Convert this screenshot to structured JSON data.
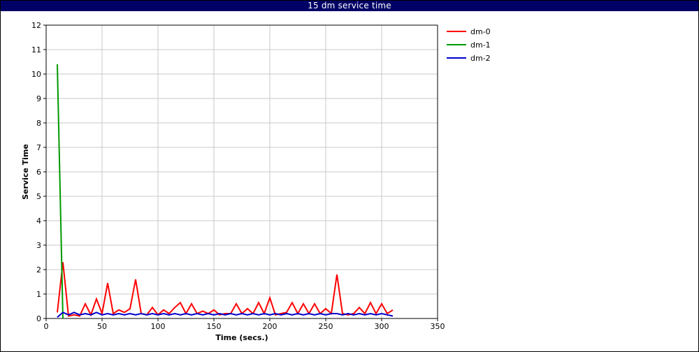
{
  "window": {
    "title": "15 dm service time"
  },
  "chart_data": {
    "type": "line",
    "title": "15 dm service time",
    "xlabel": "Time (secs.)",
    "ylabel": "Service Time",
    "xlim": [
      0,
      350
    ],
    "ylim": [
      0,
      12
    ],
    "xticks": [
      0,
      50,
      100,
      150,
      200,
      250,
      300,
      350
    ],
    "yticks": [
      0,
      1,
      2,
      3,
      4,
      5,
      6,
      7,
      8,
      9,
      10,
      11,
      12
    ],
    "grid": true,
    "legend_position": "top-right (outside plot)",
    "x": [
      10,
      15,
      20,
      25,
      30,
      35,
      40,
      45,
      50,
      55,
      60,
      65,
      70,
      75,
      80,
      85,
      90,
      95,
      100,
      105,
      110,
      115,
      120,
      125,
      130,
      135,
      140,
      145,
      150,
      155,
      160,
      165,
      170,
      175,
      180,
      185,
      190,
      195,
      200,
      205,
      210,
      215,
      220,
      225,
      230,
      235,
      240,
      245,
      250,
      255,
      260,
      265,
      270,
      275,
      280,
      285,
      290,
      295,
      300,
      305,
      310
    ],
    "series": [
      {
        "name": "dm-0",
        "color": "#ff0000",
        "values": [
          0.25,
          2.3,
          0.1,
          0.15,
          0.1,
          0.6,
          0.15,
          0.8,
          0.2,
          1.45,
          0.2,
          0.35,
          0.25,
          0.4,
          1.6,
          0.2,
          0.15,
          0.45,
          0.15,
          0.35,
          0.2,
          0.45,
          0.65,
          0.2,
          0.6,
          0.2,
          0.3,
          0.2,
          0.35,
          0.15,
          0.2,
          0.2,
          0.6,
          0.2,
          0.4,
          0.2,
          0.65,
          0.2,
          0.85,
          0.15,
          0.2,
          0.25,
          0.65,
          0.2,
          0.6,
          0.2,
          0.6,
          0.2,
          0.4,
          0.2,
          1.8,
          0.2,
          0.15,
          0.2,
          0.45,
          0.2,
          0.65,
          0.2,
          0.6,
          0.2,
          0.35
        ]
      },
      {
        "name": "dm-1",
        "color": "#009900",
        "values": [
          10.4,
          0.0
        ]
      },
      {
        "name": "dm-2",
        "color": "#0000cc",
        "values": [
          0.05,
          0.25,
          0.15,
          0.25,
          0.15,
          0.2,
          0.15,
          0.25,
          0.15,
          0.2,
          0.15,
          0.2,
          0.15,
          0.2,
          0.15,
          0.2,
          0.15,
          0.2,
          0.15,
          0.2,
          0.15,
          0.2,
          0.15,
          0.2,
          0.15,
          0.2,
          0.15,
          0.2,
          0.15,
          0.2,
          0.15,
          0.2,
          0.15,
          0.2,
          0.15,
          0.2,
          0.15,
          0.2,
          0.15,
          0.2,
          0.15,
          0.2,
          0.15,
          0.2,
          0.15,
          0.2,
          0.15,
          0.2,
          0.15,
          0.2,
          0.2,
          0.15,
          0.2,
          0.15,
          0.2,
          0.15,
          0.2,
          0.15,
          0.2,
          0.15,
          0.1
        ]
      }
    ]
  }
}
